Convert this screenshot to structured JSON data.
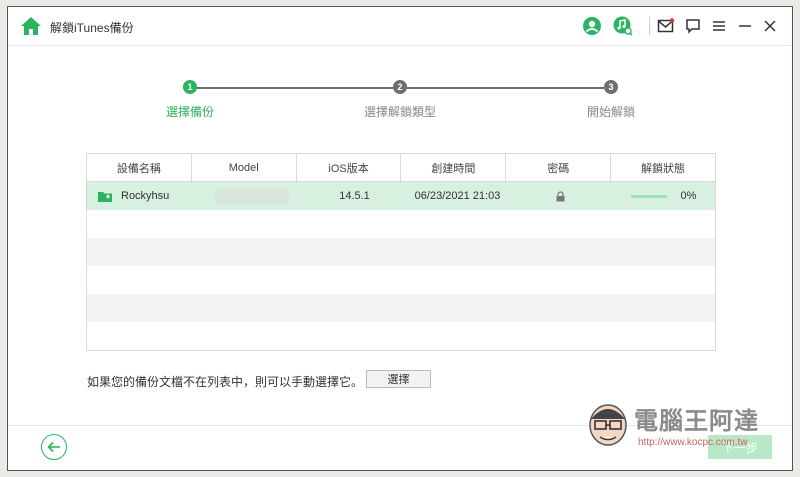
{
  "app": {
    "title": "解鎖iTunes備份"
  },
  "titlebar": {
    "icons": [
      "user-icon",
      "music-search-icon",
      "mail-icon",
      "feedback-icon",
      "menu-icon",
      "minimize-icon",
      "close-icon"
    ]
  },
  "stepper": {
    "steps": [
      {
        "number": "1",
        "label": "選擇備份",
        "state": "active"
      },
      {
        "number": "2",
        "label": "選擇解鎖類型",
        "state": "pending"
      },
      {
        "number": "3",
        "label": "開始解鎖",
        "state": "pending"
      }
    ]
  },
  "table": {
    "columns": [
      "設備名稱",
      "Model",
      "iOS版本",
      "創建時間",
      "密碼",
      "解鎖狀態"
    ],
    "rows": [
      {
        "name": "Rockyhsu",
        "model": "",
        "ios": "14.5.1",
        "created": "06/23/2021 21:03",
        "password": "lock-icon",
        "status": "0%",
        "progress": 0
      }
    ]
  },
  "footer": {
    "hint": "如果您的備份文檔不在列表中，則可以手動選擇它。",
    "choose_label": "選擇",
    "next_label": "下一步"
  },
  "watermark": {
    "title": "電腦王阿達",
    "url": "http://www.kocpc.com.tw"
  },
  "colors": {
    "accent": "#2bb35f",
    "active_step": "#2bb35f",
    "inactive_step": "#6e6e6e",
    "selected_row": "#d7f0df"
  }
}
